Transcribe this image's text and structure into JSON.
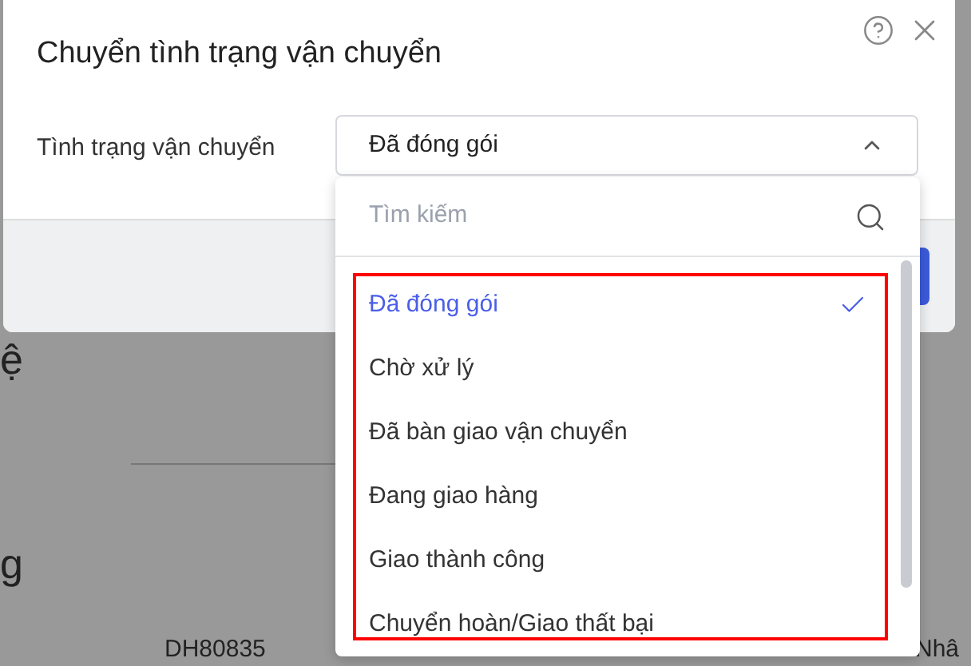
{
  "background": {
    "fragments": [
      {
        "text": "ệ",
        "kind": "heading"
      },
      {
        "text": "g",
        "kind": "heading"
      },
      {
        "text": "DH80835",
        "kind": "cell"
      },
      {
        "text": "Nhâ",
        "kind": "cell"
      }
    ]
  },
  "dialog": {
    "title": "Chuyển tình trạng vận chuyển",
    "field": {
      "label": "Tình trạng vận chuyển",
      "value": "Đã đóng gói",
      "expanded": true
    },
    "dropdown": {
      "placeholder": "Tìm kiếm",
      "options": [
        {
          "label": "Đã đóng gói",
          "selected": true
        },
        {
          "label": "Chờ xử lý",
          "selected": false
        },
        {
          "label": "Đã bàn giao vận chuyển",
          "selected": false
        },
        {
          "label": "Đang giao hàng",
          "selected": false
        },
        {
          "label": "Giao thành công",
          "selected": false
        },
        {
          "label": "Chuyển hoàn/Giao thất bại",
          "selected": false
        }
      ]
    }
  }
}
